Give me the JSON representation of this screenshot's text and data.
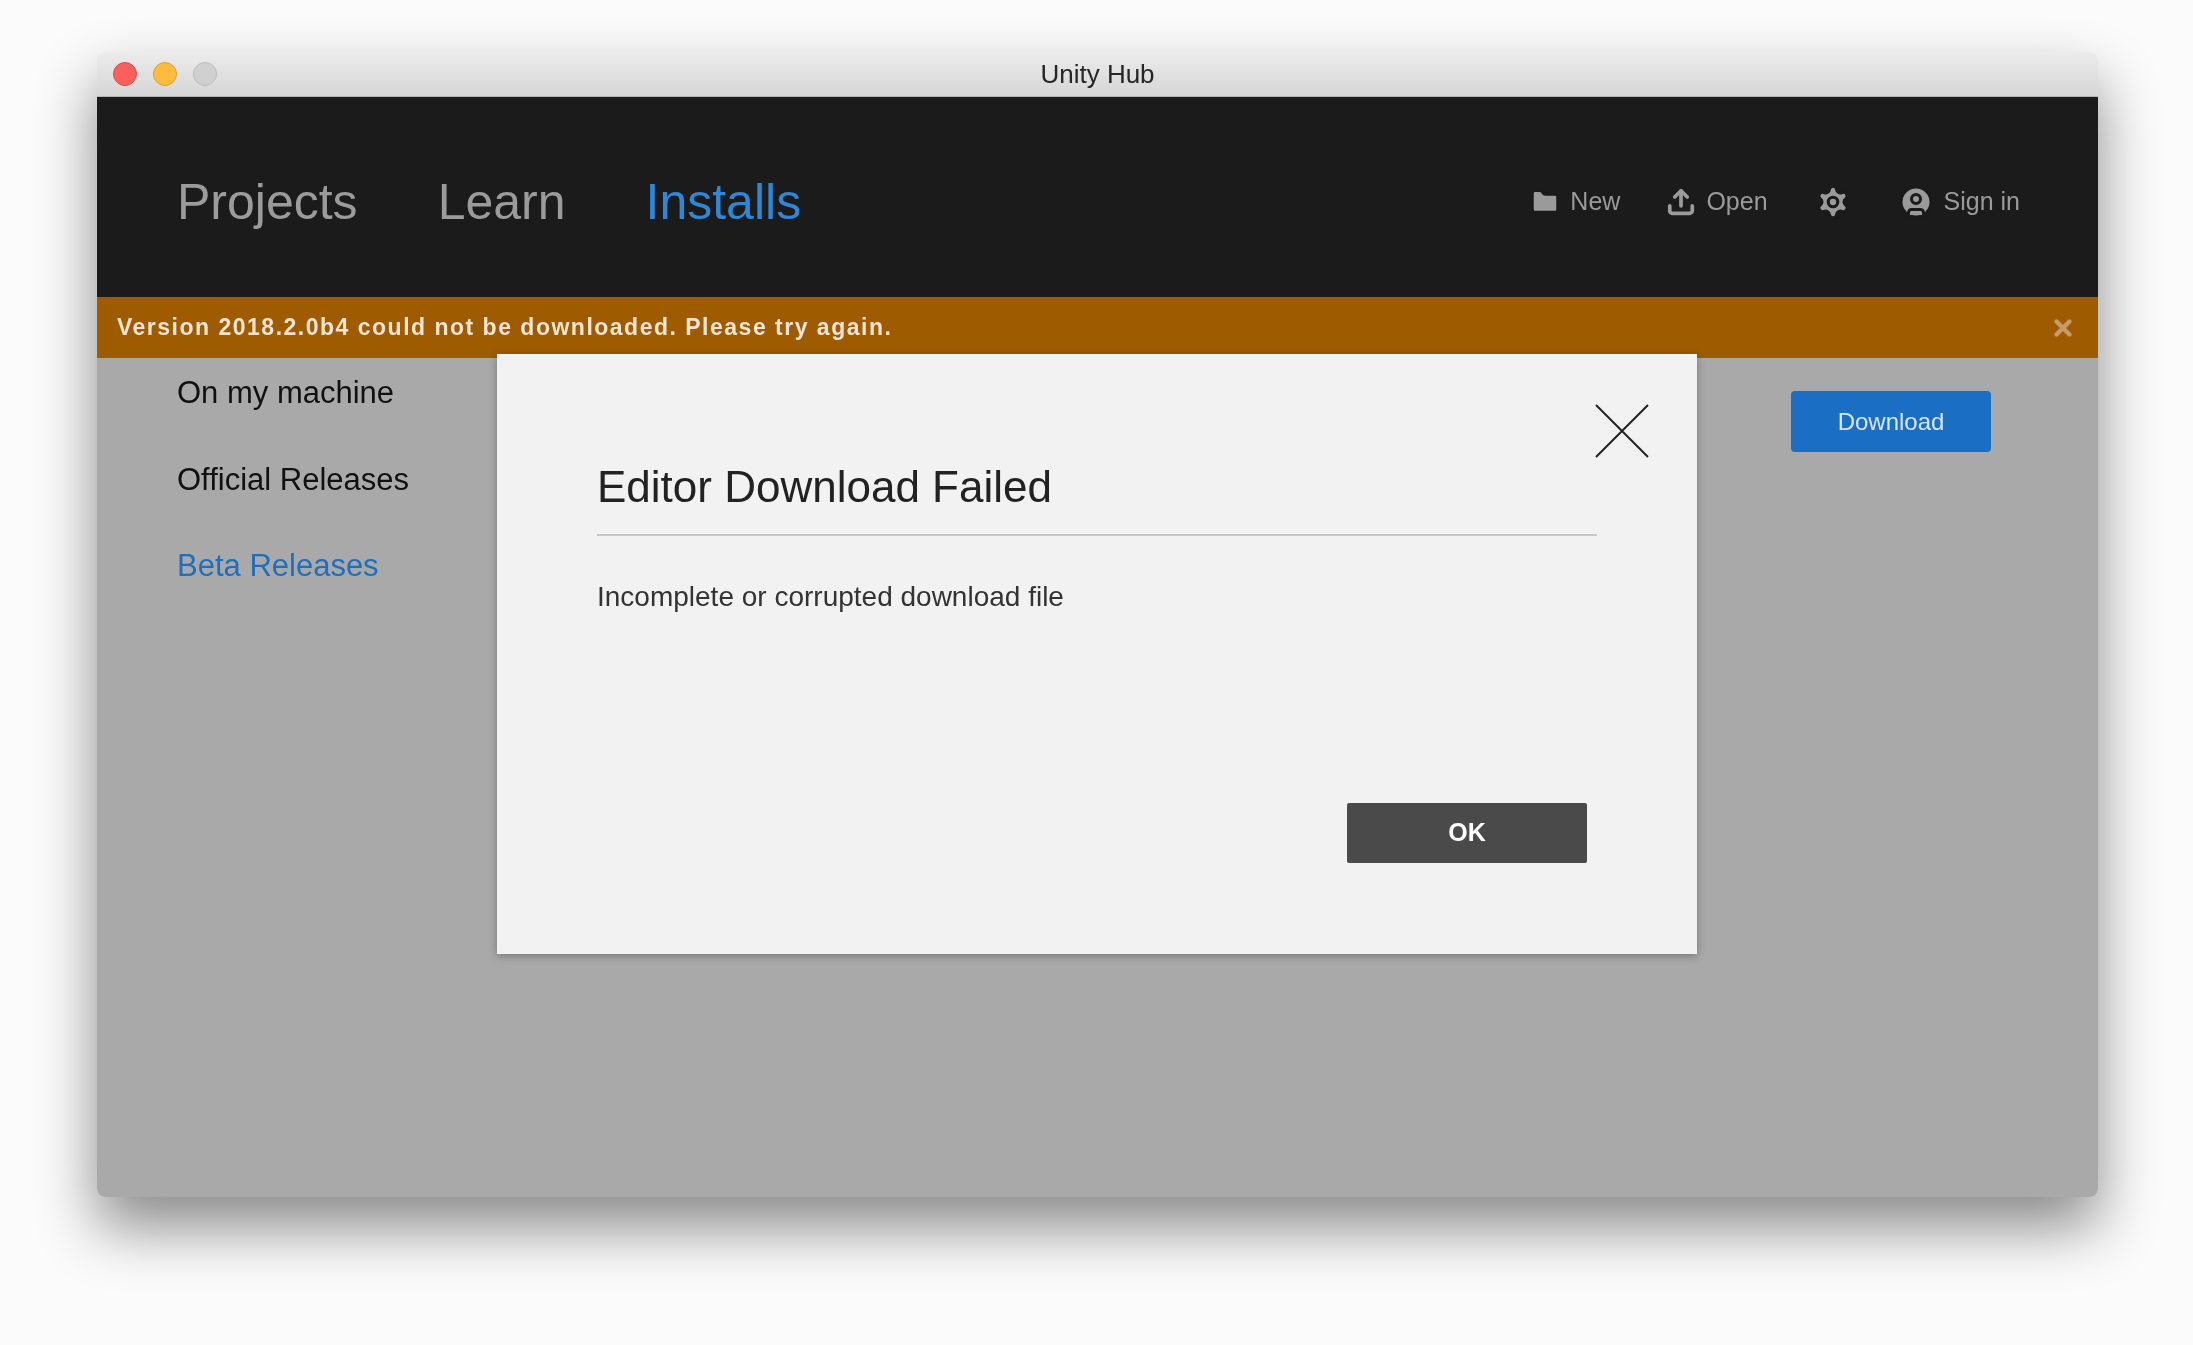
{
  "window": {
    "title": "Unity Hub"
  },
  "nav_tabs": [
    {
      "label": "Projects",
      "selected": false
    },
    {
      "label": "Learn",
      "selected": false
    },
    {
      "label": "Installs",
      "selected": true
    }
  ],
  "toolbar": [
    {
      "kind": "new",
      "label": "New"
    },
    {
      "kind": "open",
      "label": "Open"
    },
    {
      "kind": "settings"
    },
    {
      "kind": "account",
      "label": "Sign in"
    }
  ],
  "banner": {
    "message": "Version 2018.2.0b4 could not be downloaded. Please try again."
  },
  "sidebar": {
    "items": [
      {
        "label": "On my machine",
        "selected": false
      },
      {
        "label": "Official Releases",
        "selected": false
      },
      {
        "label": "Beta Releases",
        "selected": true
      }
    ]
  },
  "download_button": "Download",
  "dialog": {
    "title": "Editor Download Failed",
    "message": "Incomplete or corrupted download file",
    "button": "OK"
  }
}
